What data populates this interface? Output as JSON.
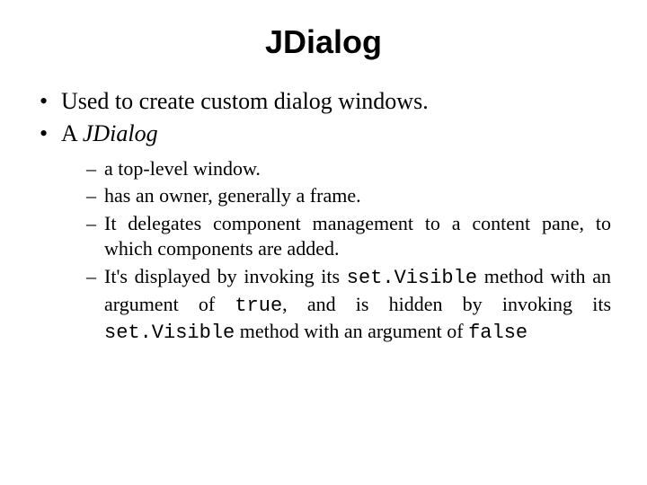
{
  "title": "JDialog",
  "bullets": {
    "b1": "Used to create custom dialog windows.",
    "b2_prefix": "A ",
    "b2_italic": "JDialog",
    "sub": {
      "s1": "a top-level window.",
      "s2": "has an owner, generally a frame.",
      "s3": "It delegates component management to a content pane, to which components are added.",
      "s4a": "It's displayed by invoking its ",
      "s4_code1": "set.Visible",
      "s4b": " method with an argument of ",
      "s4_code2": "true",
      "s4c": ", and is hidden by invoking its ",
      "s4_code3": "set.Visible",
      "s4d": " method with an argument of ",
      "s4_code4": "false"
    }
  }
}
